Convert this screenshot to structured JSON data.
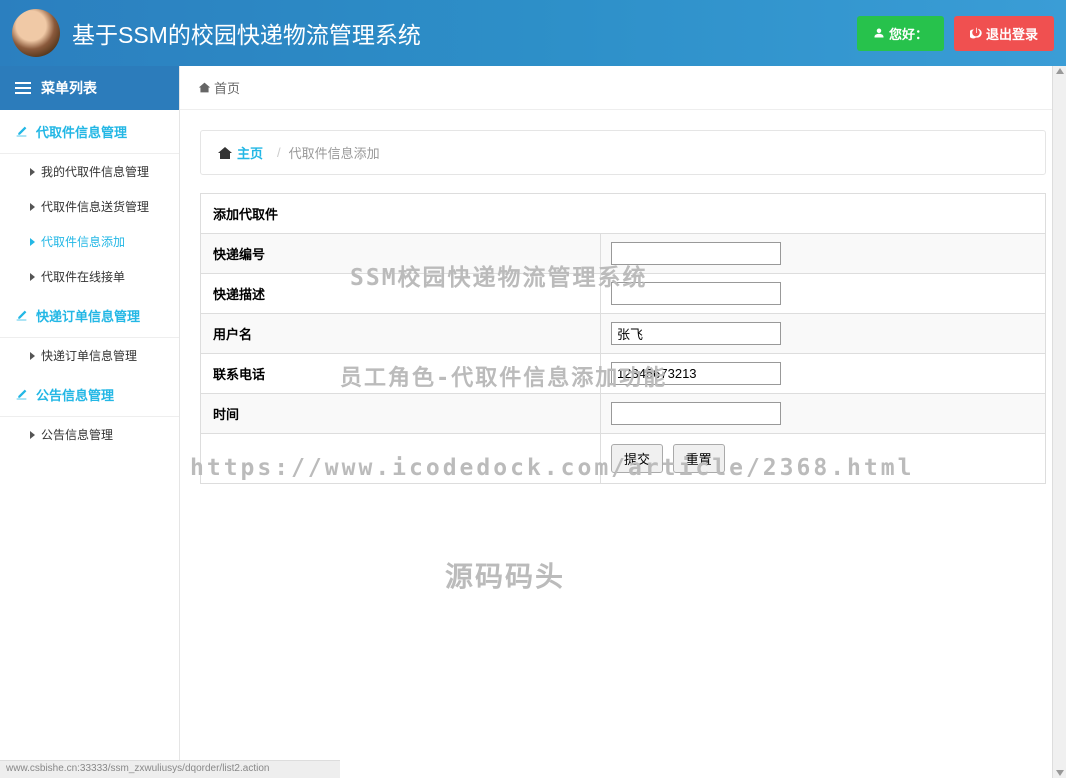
{
  "navbar": {
    "title": "基于SSM的校园快递物流管理系统",
    "hello_label": "您好：",
    "logout_label": "退出登录"
  },
  "sidebar": {
    "header": "菜单列表",
    "groups": [
      {
        "title": "代取件信息管理",
        "items": [
          "我的代取件信息管理",
          "代取件信息送货管理",
          "代取件信息添加",
          "代取件在线接单"
        ],
        "active_index": 2
      },
      {
        "title": "快递订单信息管理",
        "items": [
          "快递订单信息管理"
        ]
      },
      {
        "title": "公告信息管理",
        "items": [
          "公告信息管理"
        ]
      }
    ]
  },
  "breadcrumb": {
    "top_home": "首页",
    "home_label": "主页",
    "current": "代取件信息添加"
  },
  "form": {
    "title": "添加代取件",
    "rows": [
      {
        "label": "快递编号",
        "value": ""
      },
      {
        "label": "快递描述",
        "value": ""
      },
      {
        "label": "用户名",
        "value": "张飞"
      },
      {
        "label": "联系电话",
        "value": "12345673213"
      },
      {
        "label": "时间",
        "value": ""
      }
    ],
    "submit_label": "提交",
    "reset_label": "重置"
  },
  "watermarks": {
    "w1": "SSM校园快递物流管理系统",
    "w2": "员工角色-代取件信息添加功能",
    "w3": "https://www.icodedock.com/article/2368.html",
    "w4": "源码码头"
  },
  "status_url": "www.csbishe.cn:33333/ssm_zxwuliusys/dqorder/list2.action"
}
